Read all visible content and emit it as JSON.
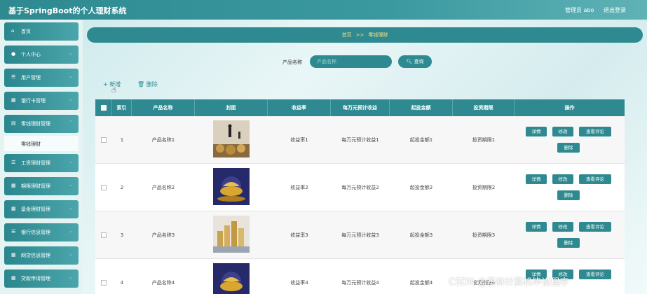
{
  "header": {
    "title": "基于SpringBoot的个人理财系统",
    "user": "管理员 abo",
    "logout": "退出登录"
  },
  "sidebar": {
    "items": [
      {
        "label": "首页",
        "icon": "home-icon"
      },
      {
        "label": "个人中心",
        "icon": "user-icon"
      },
      {
        "label": "用户管理",
        "icon": "list-icon"
      },
      {
        "label": "银行卡管理",
        "icon": "grid-icon"
      },
      {
        "label": "零钱理财管理",
        "icon": "doc-icon"
      },
      {
        "label": "零钱理财",
        "icon": ""
      },
      {
        "label": "工资理财管理",
        "icon": "list-icon"
      },
      {
        "label": "期限理财管理",
        "icon": "grid-icon"
      },
      {
        "label": "基金理财管理",
        "icon": "grid-icon"
      },
      {
        "label": "银行信息管理",
        "icon": "list-icon"
      },
      {
        "label": "网贷信息管理",
        "icon": "grid-icon"
      },
      {
        "label": "贷款申请管理",
        "icon": "grid-icon"
      }
    ]
  },
  "breadcrumb": {
    "home": "首页",
    "sep": ">>",
    "current": "零钱理财"
  },
  "search": {
    "label": "产品名称",
    "placeholder": "产品名称",
    "button": "查询"
  },
  "actions": {
    "add": "新增",
    "delete": "删除"
  },
  "table": {
    "headers": [
      "索引",
      "产品名称",
      "封面",
      "收益率",
      "每万元预计收益",
      "起投金额",
      "投资期限",
      "操作"
    ],
    "rows": [
      {
        "index": "1",
        "name": "产品名称1",
        "rate": "收益率1",
        "income": "每万元预计收益1",
        "min": "起投金额1",
        "term": "投资期限1"
      },
      {
        "index": "2",
        "name": "产品名称2",
        "rate": "收益率2",
        "income": "每万元预计收益2",
        "min": "起投金额2",
        "term": "投资期限2"
      },
      {
        "index": "3",
        "name": "产品名称3",
        "rate": "收益率3",
        "income": "每万元预计收益3",
        "min": "起投金额3",
        "term": "投资期限3"
      },
      {
        "index": "4",
        "name": "产品名称4",
        "rate": "收益率4",
        "income": "每万元预计收益4",
        "min": "起投金额4",
        "term": "投资期限4"
      }
    ],
    "buttons": {
      "detail": "详情",
      "edit": "修改",
      "comment": "查看评论",
      "delete": "删除"
    }
  },
  "watermark": "CSDN @基林计算机毕设程序",
  "colors": {
    "accent": "#2e8a90",
    "breadcrumb_text": "#f4e08a"
  }
}
